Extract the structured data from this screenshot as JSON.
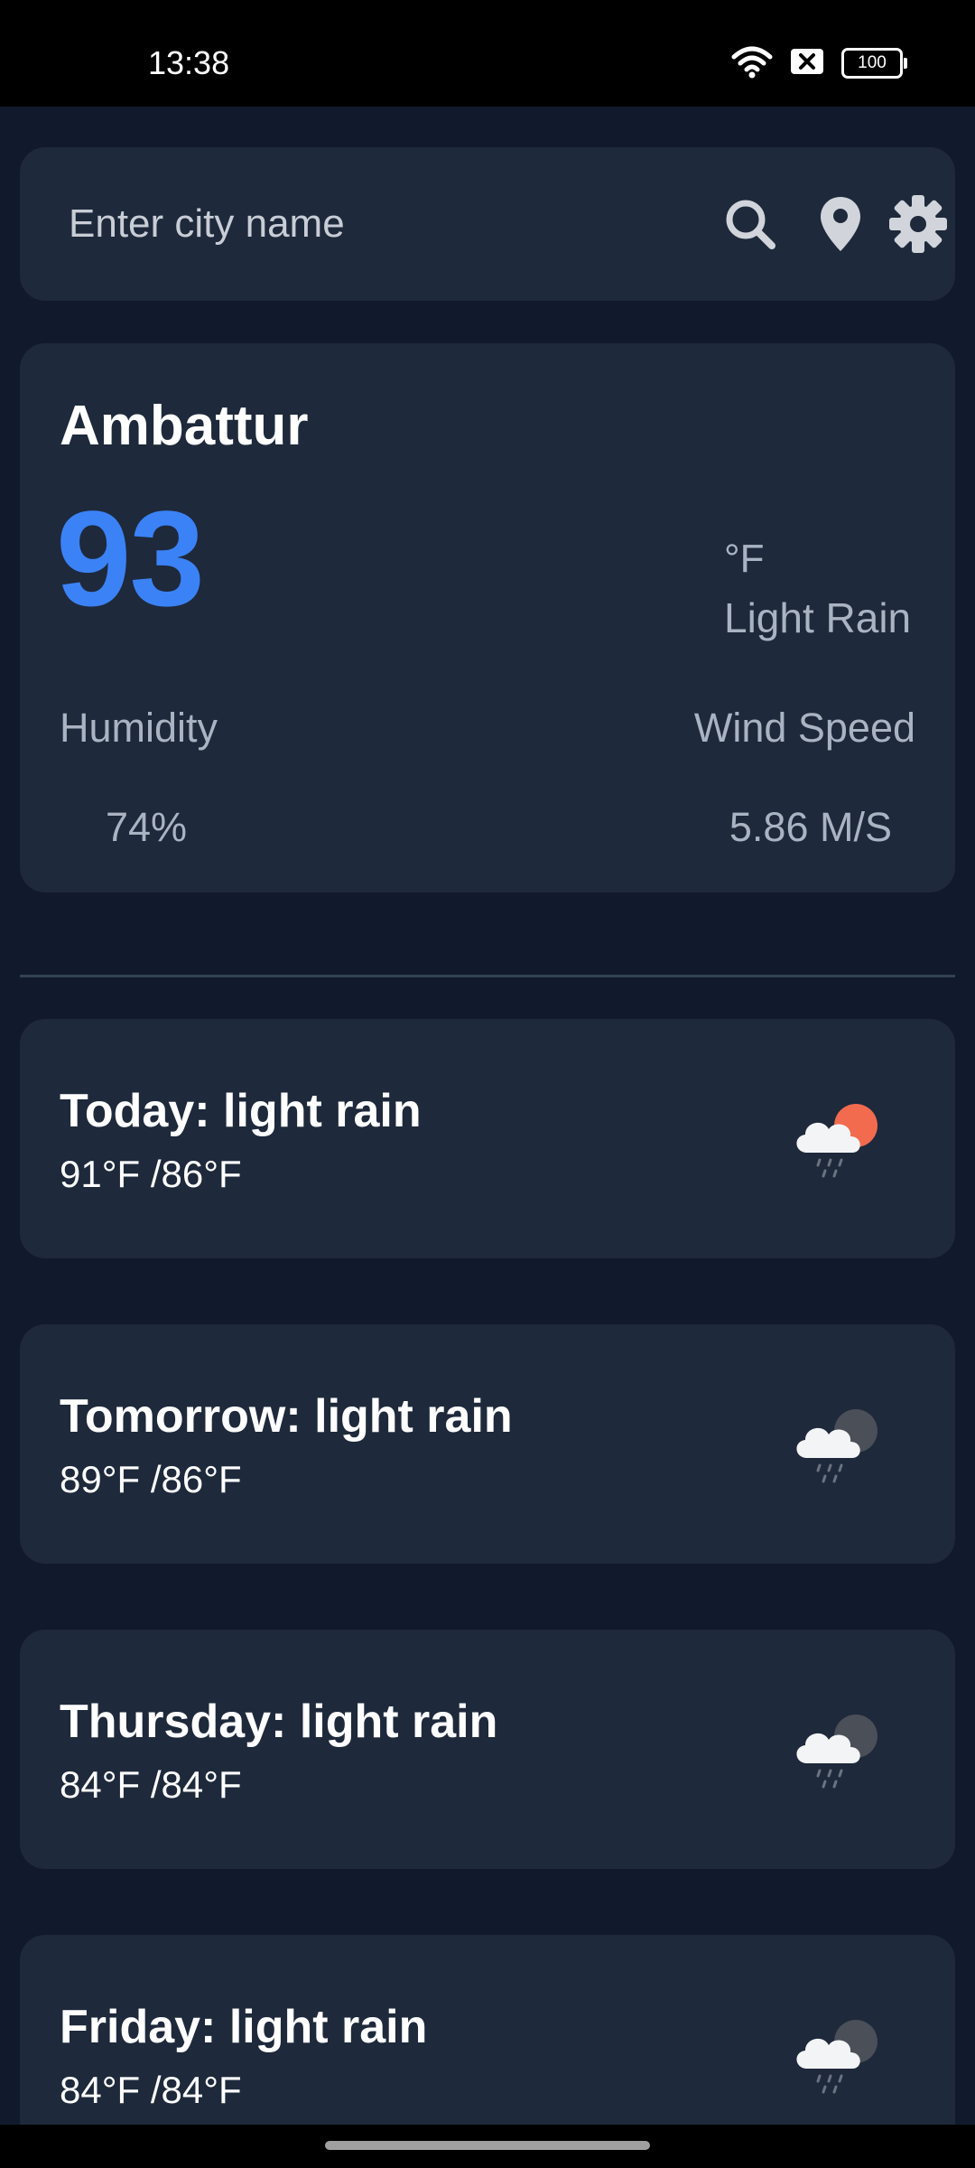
{
  "status_bar": {
    "time": "13:38",
    "battery": "100",
    "icons": [
      "wifi-icon",
      "no-sim-icon",
      "battery-icon"
    ]
  },
  "search": {
    "placeholder": "Enter city name",
    "value": "",
    "icons": [
      "search-icon",
      "location-pin-icon",
      "gear-icon"
    ]
  },
  "current": {
    "city": "Ambattur",
    "temperature": "93",
    "unit": "°F",
    "condition": "Light Rain",
    "humidity_label": "Humidity",
    "humidity_value": "74%",
    "wind_label": "Wind Speed",
    "wind_value": "5.86 M/S"
  },
  "forecast": [
    {
      "title": "Today: light rain",
      "range": "91°F /86°F",
      "icon": "rain-sun-icon"
    },
    {
      "title": "Tomorrow: light rain",
      "range": "89°F /86°F",
      "icon": "rain-moon-icon"
    },
    {
      "title": "Thursday: light rain",
      "range": "84°F /84°F",
      "icon": "rain-moon-icon"
    },
    {
      "title": "Friday: light rain",
      "range": "84°F /84°F",
      "icon": "rain-moon-icon"
    }
  ],
  "colors": {
    "background": "#111a2c",
    "card": "#1e293b",
    "accent": "#3b82f6",
    "muted_text": "#aab3c2",
    "sun": "#f26b4f",
    "moon": "#4b4f58"
  }
}
